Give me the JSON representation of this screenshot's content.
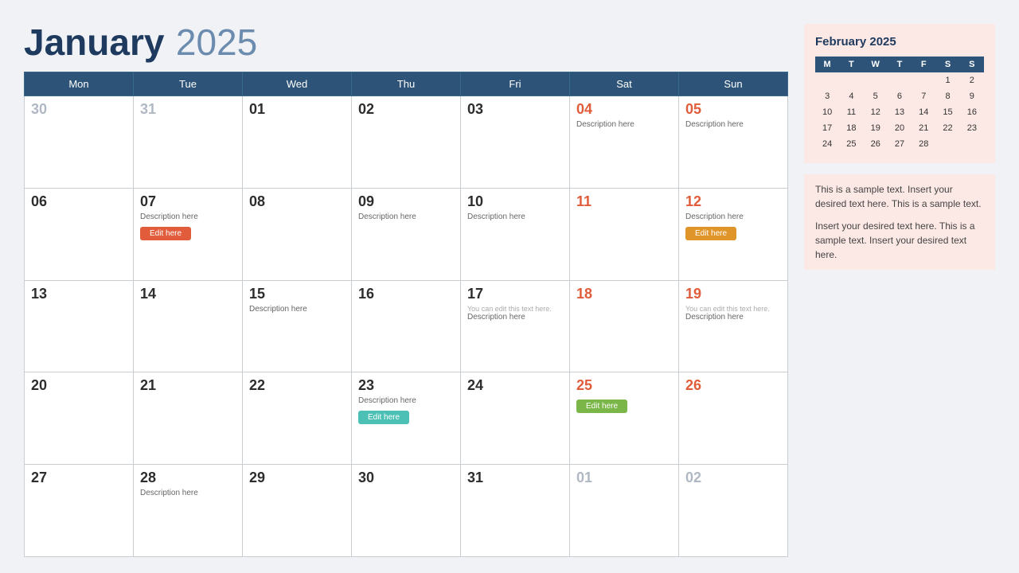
{
  "header": {
    "month": "January",
    "year": "2025"
  },
  "weekdays": [
    "Mon",
    "Tue",
    "Wed",
    "Thu",
    "Fri",
    "Sat",
    "Sun"
  ],
  "weeks": [
    [
      {
        "num": "30",
        "inactive": true,
        "desc": "",
        "note": "",
        "btn": ""
      },
      {
        "num": "31",
        "inactive": true,
        "desc": "",
        "note": "",
        "btn": ""
      },
      {
        "num": "01",
        "inactive": false,
        "desc": "",
        "note": "",
        "btn": ""
      },
      {
        "num": "02",
        "inactive": false,
        "desc": "",
        "note": "",
        "btn": ""
      },
      {
        "num": "03",
        "inactive": false,
        "desc": "",
        "note": "",
        "btn": ""
      },
      {
        "num": "04",
        "inactive": false,
        "weekend": true,
        "desc": "Description here",
        "note": "",
        "btn": ""
      },
      {
        "num": "05",
        "inactive": false,
        "weekend": true,
        "desc": "Description here",
        "note": "",
        "btn": ""
      }
    ],
    [
      {
        "num": "06",
        "inactive": false,
        "desc": "",
        "note": "",
        "btn": ""
      },
      {
        "num": "07",
        "inactive": false,
        "desc": "Description here",
        "note": "",
        "btn": "red"
      },
      {
        "num": "08",
        "inactive": false,
        "desc": "",
        "note": "",
        "btn": ""
      },
      {
        "num": "09",
        "inactive": false,
        "desc": "Description here",
        "note": "",
        "btn": ""
      },
      {
        "num": "10",
        "inactive": false,
        "desc": "Description here",
        "note": "",
        "btn": ""
      },
      {
        "num": "11",
        "inactive": false,
        "weekend": true,
        "desc": "",
        "note": "",
        "btn": ""
      },
      {
        "num": "12",
        "inactive": false,
        "weekend": true,
        "desc": "Description here",
        "note": "",
        "btn": "orange"
      }
    ],
    [
      {
        "num": "13",
        "inactive": false,
        "desc": "",
        "note": "",
        "btn": ""
      },
      {
        "num": "14",
        "inactive": false,
        "desc": "",
        "note": "",
        "btn": ""
      },
      {
        "num": "15",
        "inactive": false,
        "desc": "Description here",
        "note": "",
        "btn": ""
      },
      {
        "num": "16",
        "inactive": false,
        "desc": "",
        "note": "",
        "btn": ""
      },
      {
        "num": "17",
        "inactive": false,
        "desc": "Description here",
        "note": "You can edit this text here.",
        "btn": ""
      },
      {
        "num": "18",
        "inactive": false,
        "weekend": true,
        "desc": "",
        "note": "",
        "btn": ""
      },
      {
        "num": "19",
        "inactive": false,
        "weekend": true,
        "desc": "Description here",
        "note": "You can edit this text here.",
        "btn": ""
      }
    ],
    [
      {
        "num": "20",
        "inactive": false,
        "desc": "",
        "note": "",
        "btn": ""
      },
      {
        "num": "21",
        "inactive": false,
        "desc": "",
        "note": "",
        "btn": ""
      },
      {
        "num": "22",
        "inactive": false,
        "desc": "",
        "note": "",
        "btn": ""
      },
      {
        "num": "23",
        "inactive": false,
        "desc": "Description here",
        "note": "",
        "btn": "teal"
      },
      {
        "num": "24",
        "inactive": false,
        "desc": "",
        "note": "",
        "btn": ""
      },
      {
        "num": "25",
        "inactive": false,
        "weekend": true,
        "desc": "",
        "note": "",
        "btn": "green"
      },
      {
        "num": "26",
        "inactive": false,
        "weekend": true,
        "desc": "",
        "note": "",
        "btn": ""
      }
    ],
    [
      {
        "num": "27",
        "inactive": false,
        "desc": "",
        "note": "",
        "btn": ""
      },
      {
        "num": "28",
        "inactive": false,
        "desc": "Description here",
        "note": "",
        "btn": ""
      },
      {
        "num": "29",
        "inactive": false,
        "desc": "",
        "note": "",
        "btn": ""
      },
      {
        "num": "30",
        "inactive": false,
        "desc": "",
        "note": "",
        "btn": ""
      },
      {
        "num": "31",
        "inactive": false,
        "desc": "",
        "note": "",
        "btn": ""
      },
      {
        "num": "01",
        "inactive": true,
        "desc": "",
        "note": "",
        "btn": ""
      },
      {
        "num": "02",
        "inactive": true,
        "desc": "",
        "note": "",
        "btn": ""
      }
    ]
  ],
  "btn_labels": {
    "red": "Edit here",
    "orange": "Edit here",
    "teal": "Edit here",
    "green": "Edit here"
  },
  "mini_cal": {
    "title": "February 2025",
    "headers": [
      "M",
      "T",
      "W",
      "T",
      "F",
      "S",
      "S"
    ],
    "rows": [
      [
        "",
        "",
        "",
        "",
        "",
        "1",
        "2"
      ],
      [
        "3",
        "4",
        "5",
        "6",
        "7",
        "8",
        "9"
      ],
      [
        "10",
        "11",
        "12",
        "13",
        "14",
        "15",
        "16"
      ],
      [
        "17",
        "18",
        "19",
        "20",
        "21",
        "22",
        "23"
      ],
      [
        "24",
        "25",
        "26",
        "27",
        "28",
        "",
        ""
      ]
    ]
  },
  "sidebar_text": {
    "para1": "This is a sample text. Insert your desired text here. This is a sample text.",
    "para2": "Insert your desired text here. This is a sample text. Insert your desired text here."
  }
}
